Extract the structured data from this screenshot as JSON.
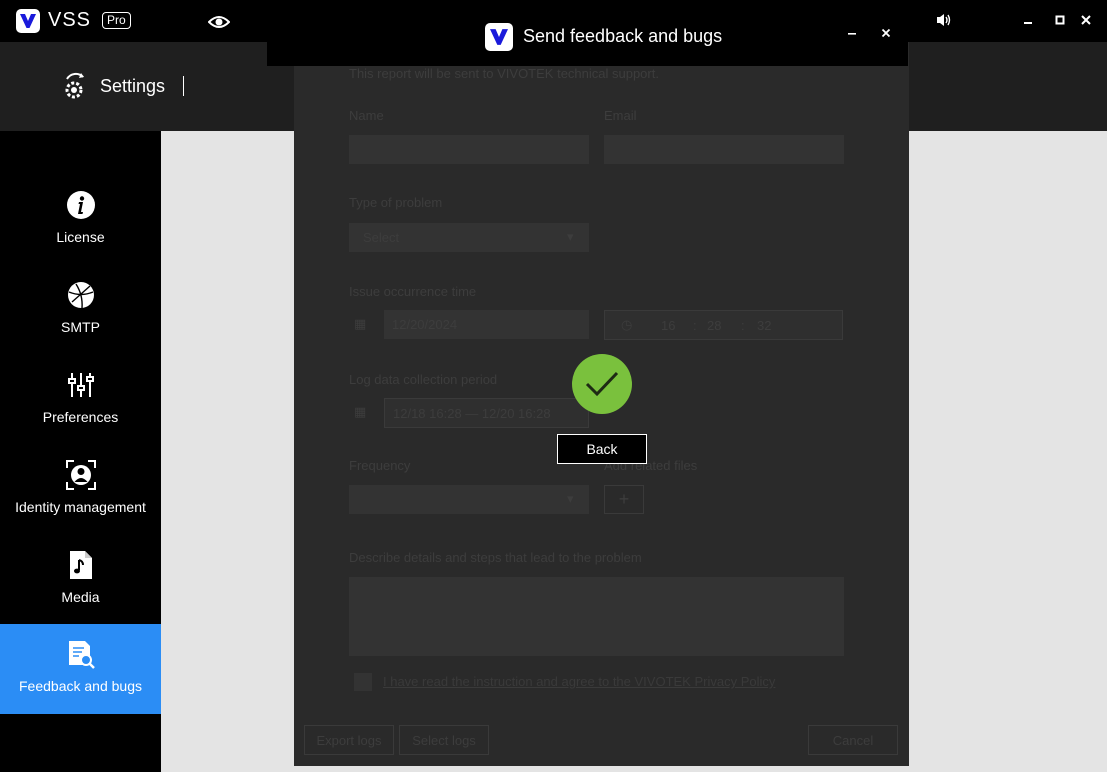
{
  "app": {
    "name": "VSS",
    "edition": "Pro",
    "colors": {
      "accent": "#2b8df5",
      "brand": "#1a1adb",
      "success": "#7ac13d"
    }
  },
  "header": {
    "title": "Settings"
  },
  "sidebar": {
    "items": [
      {
        "label": "License",
        "icon": "info-icon"
      },
      {
        "label": "SMTP",
        "icon": "globe-icon"
      },
      {
        "label": "Preferences",
        "icon": "sliders-icon"
      },
      {
        "label": "Identity management",
        "icon": "user-scan-icon"
      },
      {
        "label": "Media",
        "icon": "music-file-icon"
      },
      {
        "label": "Feedback and bugs",
        "icon": "document-search-icon",
        "active": true
      }
    ]
  },
  "dialog": {
    "title": "Send feedback and bugs",
    "intro": "This report will be sent to VIVOTEK technical support.",
    "name_label": "Name",
    "email_label": "Email",
    "type_label": "Type of problem",
    "type_value": "Select",
    "issue_time_label": "Issue occurrence time",
    "issue_date": "12/20/2024",
    "issue_time": {
      "hour": "16",
      "minute": "28",
      "second": "32"
    },
    "log_period_label": "Log data collection period",
    "log_period_value": "12/18 16:28 — 12/20 16:28",
    "frequency_label": "Frequency",
    "related_files_label": "Add related files",
    "description_label": "Describe details and steps that lead to the problem",
    "privacy_text": "I have read the instruction and agree to the VIVOTEK Privacy Policy",
    "buttons": {
      "export_logs": "Export logs",
      "select_logs": "Select logs",
      "cancel": "Cancel",
      "back": "Back"
    }
  }
}
